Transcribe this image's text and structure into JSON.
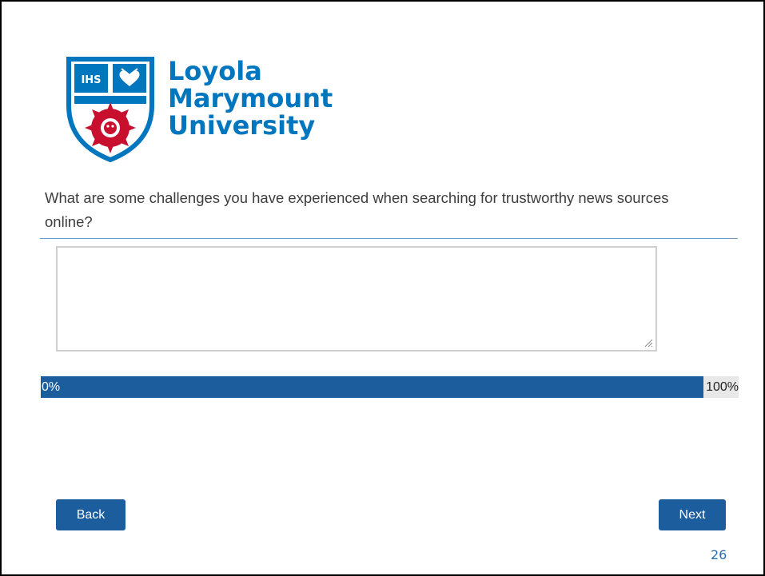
{
  "logo": {
    "monogram": "IHS",
    "line1": "Loyola",
    "line2": "Marymount",
    "line3": "University"
  },
  "survey": {
    "question": "What are some challenges you have experienced when searching for trustworthy news sources online?",
    "answer_value": "",
    "progress": {
      "percent_complete": 95,
      "start_label": "0%",
      "end_label": "100%"
    }
  },
  "buttons": {
    "back_label": "Back",
    "next_label": "Next"
  },
  "page_number": "26",
  "colors": {
    "brand_blue": "#0076be",
    "button_blue": "#1c5d9e",
    "shield_red": "#c8102e"
  },
  "icons": {
    "logo": "lmu-shield-icon",
    "resize": "resize-grip-icon"
  }
}
